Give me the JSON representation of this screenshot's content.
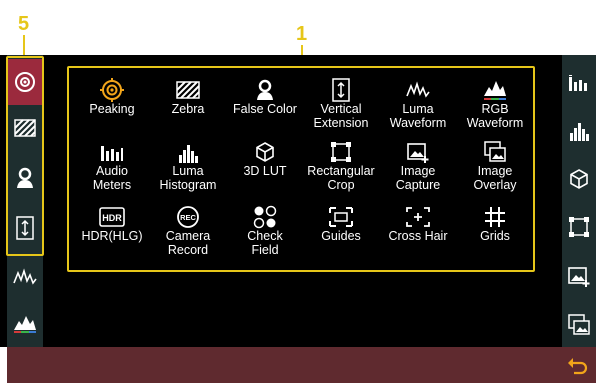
{
  "callouts": {
    "left": "5",
    "grid": "1"
  },
  "left_rail": {
    "items": [
      {
        "icon": "peaking-icon",
        "active": true
      },
      {
        "icon": "zebra-icon",
        "active": false
      },
      {
        "icon": "false-color-icon",
        "active": false
      },
      {
        "icon": "vertical-extension-icon",
        "active": false
      },
      {
        "icon": "luma-waveform-icon",
        "active": false
      },
      {
        "icon": "rgb-waveform-icon",
        "active": false
      }
    ]
  },
  "right_rail": {
    "items": [
      {
        "icon": "audio-meters-icon"
      },
      {
        "icon": "luma-histogram-icon"
      },
      {
        "icon": "3d-lut-icon"
      },
      {
        "icon": "rectangular-crop-icon"
      },
      {
        "icon": "image-capture-icon"
      },
      {
        "icon": "image-overlay-icon"
      }
    ],
    "back_icon": "back-arrow-icon"
  },
  "grid": {
    "tiles": [
      {
        "id": "peaking",
        "label": "Peaking",
        "icon": "peaking-icon"
      },
      {
        "id": "zebra",
        "label": "Zebra",
        "icon": "zebra-icon"
      },
      {
        "id": "false-color",
        "label": "False Color",
        "icon": "false-color-icon"
      },
      {
        "id": "vertical-extension",
        "label": "Vertical\nExtension",
        "icon": "vertical-extension-icon"
      },
      {
        "id": "luma-waveform",
        "label": "Luma\nWaveform",
        "icon": "luma-waveform-icon"
      },
      {
        "id": "rgb-waveform",
        "label": "RGB\nWaveform",
        "icon": "rgb-waveform-icon"
      },
      {
        "id": "audio-meters",
        "label": "Audio\nMeters",
        "icon": "audio-meters-icon"
      },
      {
        "id": "luma-histogram",
        "label": "Luma\nHistogram",
        "icon": "luma-histogram-icon"
      },
      {
        "id": "3d-lut",
        "label": "3D LUT",
        "icon": "3d-lut-icon"
      },
      {
        "id": "rectangular-crop",
        "label": "Rectangular\nCrop",
        "icon": "rectangular-crop-icon"
      },
      {
        "id": "image-capture",
        "label": "Image\nCapture",
        "icon": "image-capture-icon"
      },
      {
        "id": "image-overlay",
        "label": "Image\nOverlay",
        "icon": "image-overlay-icon"
      },
      {
        "id": "hdr-hlg",
        "label": "HDR(HLG)",
        "icon": "hdr-icon"
      },
      {
        "id": "camera-record",
        "label": "Camera\nRecord",
        "icon": "rec-icon"
      },
      {
        "id": "check-field",
        "label": "Check\nField",
        "icon": "check-field-icon"
      },
      {
        "id": "guides",
        "label": "Guides",
        "icon": "guides-icon"
      },
      {
        "id": "cross-hair",
        "label": "Cross Hair",
        "icon": "cross-hair-icon"
      },
      {
        "id": "grids",
        "label": "Grids",
        "icon": "grids-icon"
      }
    ]
  },
  "colors": {
    "highlight": "#e6c619",
    "active": "#9b2a3d",
    "peaking": "#f2a51a",
    "bottom_bar": "#5f2a2f"
  }
}
